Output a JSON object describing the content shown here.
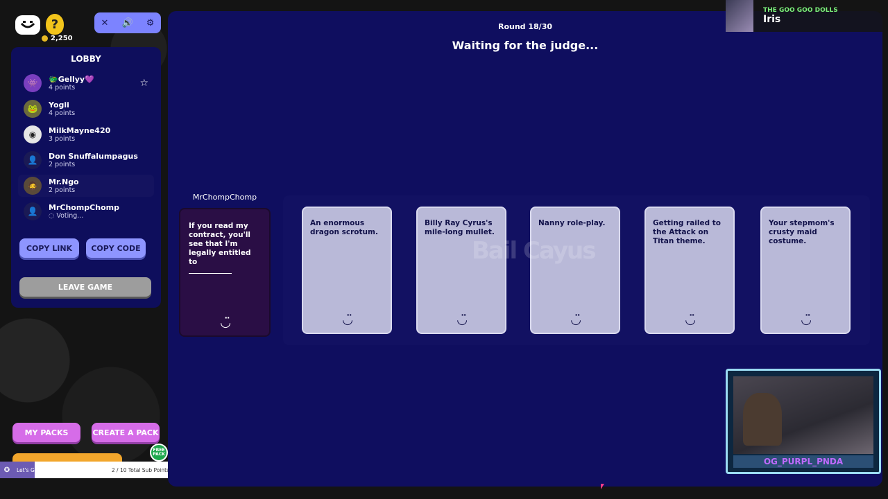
{
  "topbar": {
    "coins": "2,250",
    "help_label": "?",
    "icons": [
      "pencil-mute-icon",
      "volume-icon",
      "gear-icon"
    ]
  },
  "lobby": {
    "title": "LOBBY",
    "players": [
      {
        "name": "Gellyy",
        "points": "4 points",
        "emoji": "🐲",
        "heart": "💜"
      },
      {
        "name": "Yogii",
        "points": "4 points"
      },
      {
        "name": "MilkMayne420",
        "points": "3 points"
      },
      {
        "name": "Don Snuffalumpagus",
        "points": "2 points"
      },
      {
        "name": "Mr.Ngo",
        "points": "2 points"
      },
      {
        "name": "MrChompChomp",
        "points": "Voting..."
      }
    ],
    "copy_link": "COPY LINK",
    "copy_code": "COPY CODE",
    "leave_game": "LEAVE GAME"
  },
  "bottom": {
    "my_packs": "MY PACKS",
    "create_pack": "CREATE A PACK",
    "free_pack": "FREE PACK",
    "sub_goal": "Let's Grow The Community!!!!",
    "sub_points": "2 / 10 Total Sub Points",
    "sub_progress": 0.2
  },
  "game": {
    "round": "Round 18/30",
    "status": "Waiting for the judge...",
    "question_owner": "MrChompChomp",
    "question_text": "If you read my contract, you'll see that I'm legally entitled to",
    "answers": [
      "An enormous dragon scrotum.",
      "Billy Ray Cyrus's mile-long mullet.",
      "Nanny role-play.",
      "Getting railed to the Attack on Titan theme.",
      "Your stepmom's crusty maid costume."
    ],
    "watermark": "Bail Cayus",
    "card_logo": "◡̈"
  },
  "music": {
    "artist": "THE GOO GOO DOLLS",
    "title": "Iris"
  },
  "webcam": {
    "name": "OG_PURPL_PNDA"
  }
}
